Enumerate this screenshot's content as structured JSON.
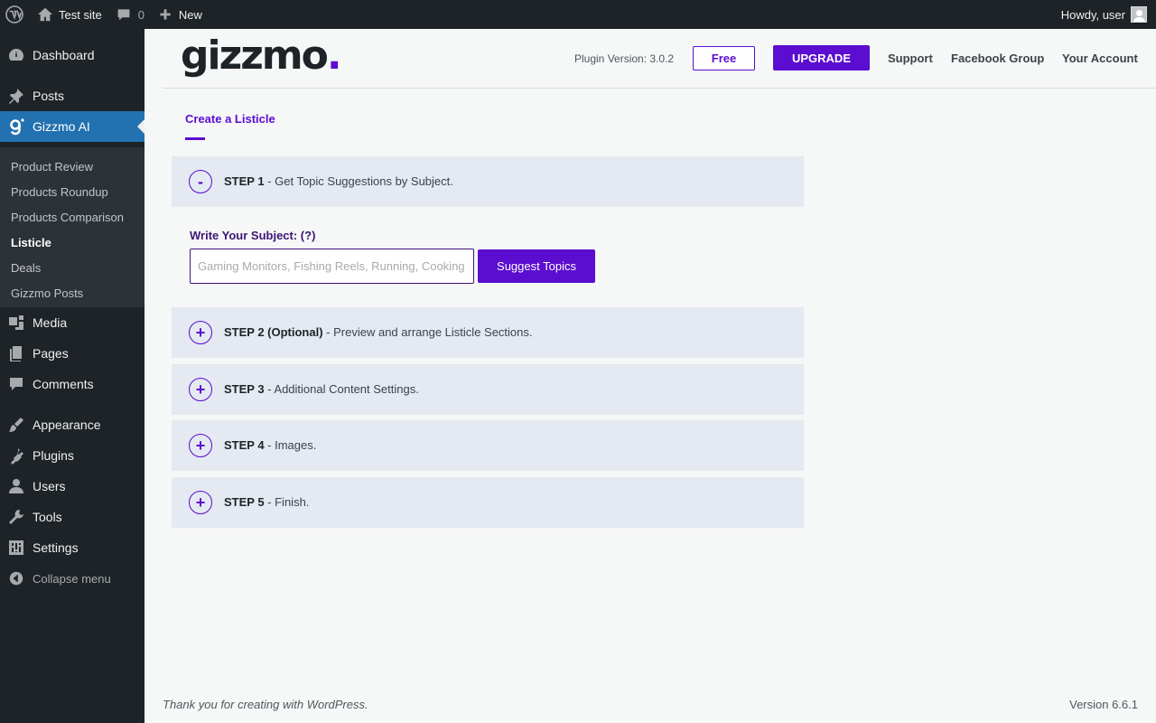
{
  "admin_bar": {
    "site_name": "Test site",
    "comments_count": "0",
    "new_label": "New",
    "greeting": "Howdy, user"
  },
  "sidebar": {
    "items": [
      {
        "label": "Dashboard",
        "icon": "dashboard-icon"
      },
      {
        "label": "Posts",
        "icon": "pin-icon"
      },
      {
        "label": "Gizzmo AI",
        "icon": "gizzmo-icon"
      },
      {
        "label": "Media",
        "icon": "media-icon"
      },
      {
        "label": "Pages",
        "icon": "pages-icon"
      },
      {
        "label": "Comments",
        "icon": "comment-icon"
      },
      {
        "label": "Appearance",
        "icon": "paintbrush-icon"
      },
      {
        "label": "Plugins",
        "icon": "plugin-icon"
      },
      {
        "label": "Users",
        "icon": "user-icon"
      },
      {
        "label": "Tools",
        "icon": "wrench-icon"
      },
      {
        "label": "Settings",
        "icon": "settings-icon"
      }
    ],
    "submenu": [
      {
        "label": "Product Review"
      },
      {
        "label": "Products Roundup"
      },
      {
        "label": "Products Comparison"
      },
      {
        "label": "Listicle"
      },
      {
        "label": "Deals"
      },
      {
        "label": "Gizzmo Posts"
      }
    ],
    "collapse_label": "Collapse menu",
    "accent_color": "#2271b1"
  },
  "header": {
    "logo_text": "gizzmo",
    "logo_dot": ".",
    "plugin_version": "Plugin Version: 3.0.2",
    "free_label": "Free",
    "upgrade_label": "UPGRADE",
    "links": [
      "Support",
      "Facebook Group",
      "Your Account"
    ],
    "brand_color": "#5b0dd0"
  },
  "tab": {
    "label": "Create a Listicle"
  },
  "steps": [
    {
      "toggle": "-",
      "title": "STEP 1",
      "desc": " - Get Topic Suggestions by Subject."
    },
    {
      "toggle": "+",
      "title": "STEP 2 (Optional)",
      "desc": " - Preview and arrange Listicle Sections."
    },
    {
      "toggle": "+",
      "title": "STEP 3",
      "desc": " - Additional Content Settings."
    },
    {
      "toggle": "+",
      "title": "STEP 4",
      "desc": " - Images."
    },
    {
      "toggle": "+",
      "title": "STEP 5",
      "desc": " - Finish."
    }
  ],
  "subject": {
    "label": "Write Your Subject: (?)",
    "placeholder": "Gaming Monitors, Fishing Reels, Running, Cooking",
    "value": "",
    "button": "Suggest Topics"
  },
  "footer": {
    "thanks": "Thank you for creating with WordPress.",
    "version": "Version 6.6.1"
  }
}
